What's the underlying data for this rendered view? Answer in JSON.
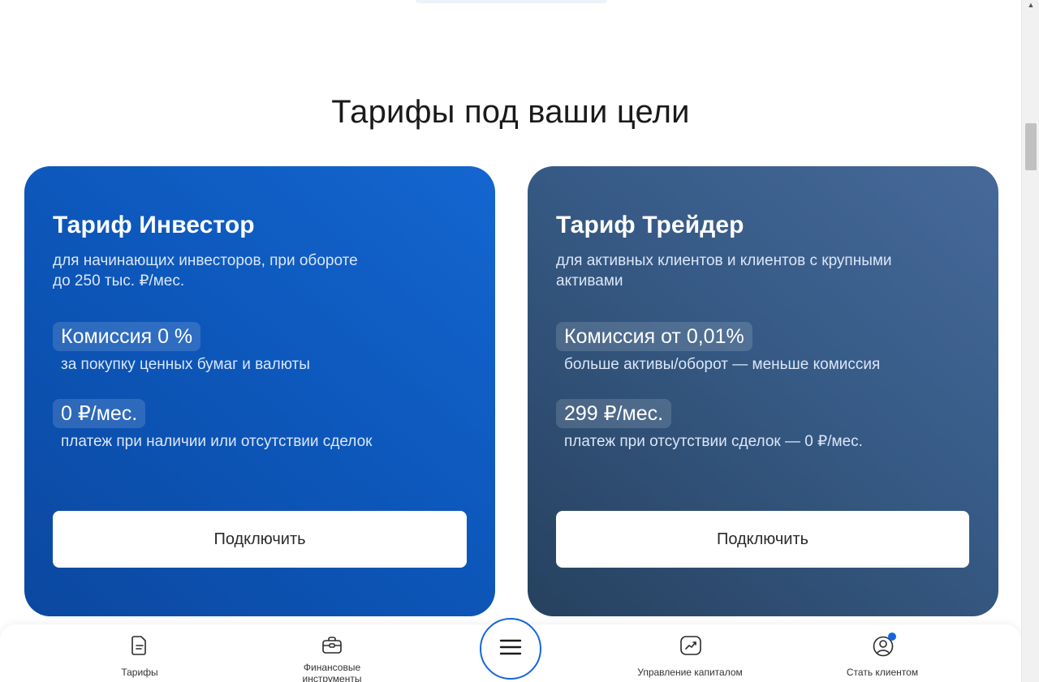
{
  "section": {
    "title": "Тарифы под ваши цели"
  },
  "cards": [
    {
      "title": "Тариф Инвестор",
      "subtitle_line1": "для начинающих инвесторов, при обороте",
      "subtitle_line2": "до 250 тыс. ₽/мес.",
      "feature1_value": "Комиссия 0 %",
      "feature1_caption": "за покупку ценных бумаг и валюты",
      "feature2_value": "0 ₽/мес.",
      "feature2_caption": "платеж при наличии или отсутствии сделок",
      "button_label": "Подключить"
    },
    {
      "title": "Тариф Трейдер",
      "subtitle_line1": "для активных клиентов и клиентов с крупными",
      "subtitle_line2": "активами",
      "feature1_value": "Комиссия от 0,01%",
      "feature1_caption": "больше активы/оборот — меньше комиссия",
      "feature2_value": "299 ₽/мес.",
      "feature2_caption": "платеж при отсутствии сделок — 0 ₽/мес.",
      "button_label": "Подключить"
    }
  ],
  "bottom_nav": {
    "items": [
      {
        "label": "Тарифы",
        "icon": "document-icon"
      },
      {
        "label": "Финансовые инструменты",
        "icon": "briefcase-icon"
      },
      {
        "label": "Управление капиталом",
        "icon": "chart-up-icon"
      },
      {
        "label": "Стать клиентом",
        "icon": "user-circle-icon"
      }
    ],
    "menu_icon": "hamburger-icon"
  },
  "colors": {
    "accent": "#1565e0",
    "investor_card": "#0d58bc",
    "trader_card": "#365a85"
  }
}
